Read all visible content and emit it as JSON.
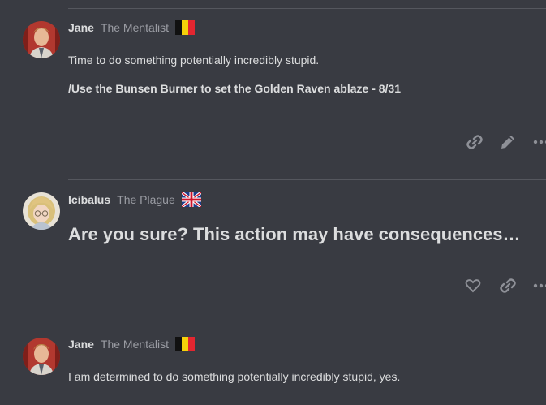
{
  "posts": [
    {
      "username": "Jane",
      "user_title": "The Mentalist",
      "flag": "belgium-flag",
      "lines": [
        "Time to do something potentially incredibly stupid.",
        "/Use the Bunsen Burner to set the Golden Raven ablaze - 8/31"
      ],
      "actions": [
        "link-icon",
        "pencil-icon",
        "more-icon"
      ]
    },
    {
      "username": "Icibalus",
      "user_title": "The Plague",
      "flag": "uk-flag",
      "lines": [
        "Are you sure? This action may have consequences…"
      ],
      "actions": [
        "heart-icon",
        "link-icon",
        "more-icon"
      ]
    },
    {
      "username": "Jane",
      "user_title": "The Mentalist",
      "flag": "belgium-flag",
      "lines": [
        "I am determined to do something potentially incredibly stupid, yes."
      ]
    }
  ],
  "colors": {
    "background": "#393b42",
    "divider": "#55575e",
    "text": "#dcddde",
    "muted": "#9a9ca3",
    "icon": "#8e9097"
  }
}
